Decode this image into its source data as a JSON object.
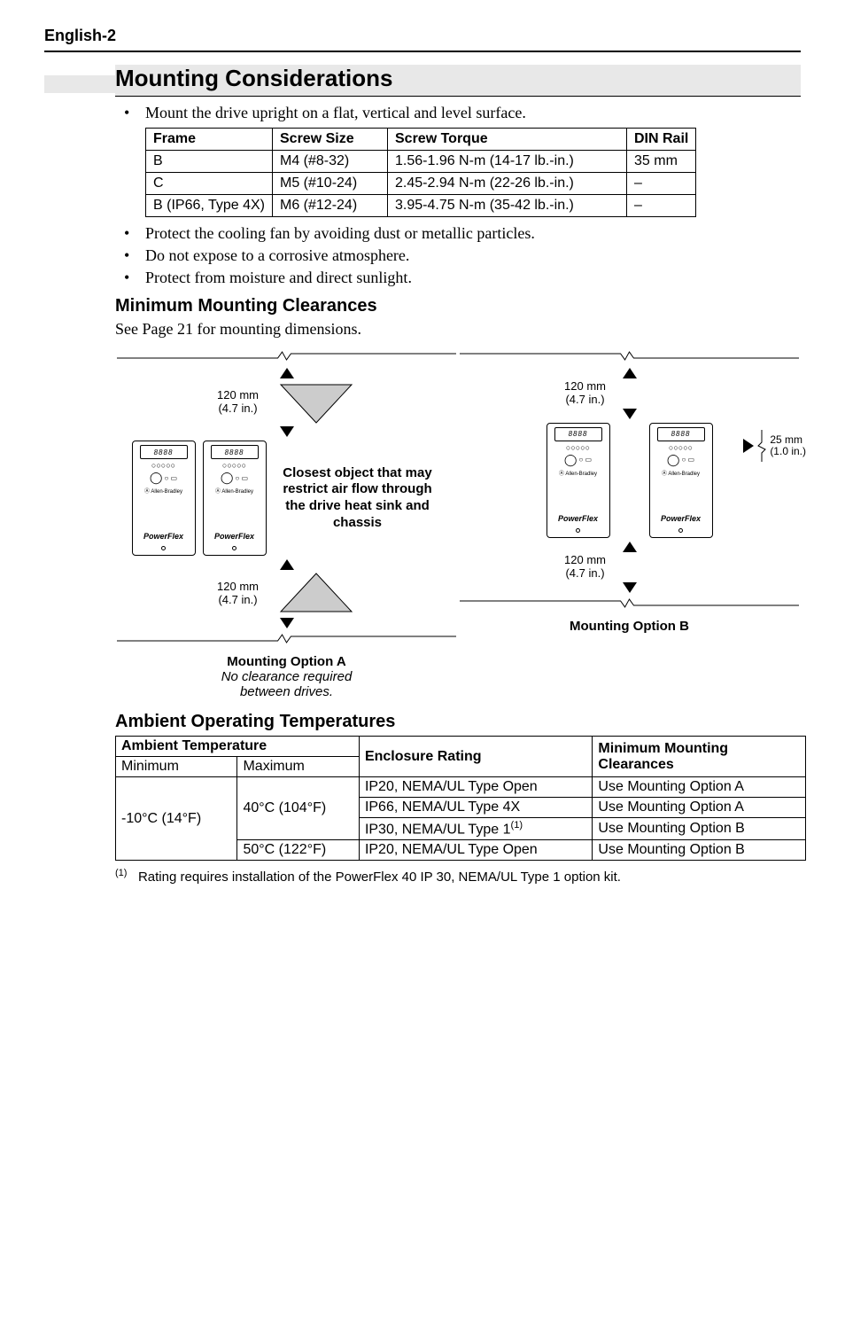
{
  "header": "English-2",
  "section_title": "Mounting Considerations",
  "bullets_top": [
    "Mount the drive upright on a flat, vertical and level surface."
  ],
  "screw_table": {
    "headers": [
      "Frame",
      "Screw Size",
      "Screw Torque",
      "DIN Rail"
    ],
    "rows": [
      [
        "B",
        "M4 (#8-32)",
        "1.56-1.96 N-m (14-17 lb.-in.)",
        "35 mm"
      ],
      [
        "C",
        "M5 (#10-24)",
        "2.45-2.94 N-m (22-26 lb.-in.)",
        "–"
      ],
      [
        "B (IP66, Type 4X)",
        "M6 (#12-24)",
        "3.95-4.75 N-m (35-42 lb.-in.)",
        "–"
      ]
    ]
  },
  "bullets_after": [
    "Protect the cooling fan by avoiding dust or metallic particles.",
    "Do not expose to a corrosive atmosphere.",
    "Protect from moisture and direct sunlight."
  ],
  "sub1_title": "Minimum Mounting Clearances",
  "sub1_text": "See Page 21 for mounting dimensions.",
  "diagram": {
    "dim_vert": "120 mm\n(4.7 in.)",
    "dim_side": "25 mm\n(1.0 in.)",
    "center_text": "Closest object that may restrict air flow through the drive heat sink and chassis",
    "drive_display": "8888",
    "drive_brand": "Allen-Bradley",
    "drive_series": "PowerFlex",
    "caption_a_bold": "Mounting Option A",
    "caption_a_it1": "No clearance required",
    "caption_a_it2": "between drives.",
    "caption_b_bold": "Mounting Option B"
  },
  "sub2_title": "Ambient Operating Temperatures",
  "ambient_table": {
    "h_ambient": "Ambient Temperature",
    "h_enclosure": "Enclosure Rating",
    "h_clear": "Minimum Mounting Clearances",
    "h_min": "Minimum",
    "h_max": "Maximum",
    "min_val": "-10°C (14°F)",
    "max1": "40°C (104°F)",
    "max2": "50°C (122°F)",
    "rows": [
      [
        "IP20, NEMA/UL Type Open",
        "Use Mounting Option A"
      ],
      [
        "IP66, NEMA/UL Type 4X",
        "Use Mounting Option A"
      ],
      [
        "IP30, NEMA/UL Type 1",
        "Use Mounting Option B"
      ],
      [
        "IP20, NEMA/UL Type Open",
        "Use Mounting Option B"
      ]
    ],
    "sup": "(1)"
  },
  "footnote_marker": "(1)",
  "footnote_text": "Rating requires installation of the PowerFlex 40 IP 30, NEMA/UL Type 1 option kit."
}
